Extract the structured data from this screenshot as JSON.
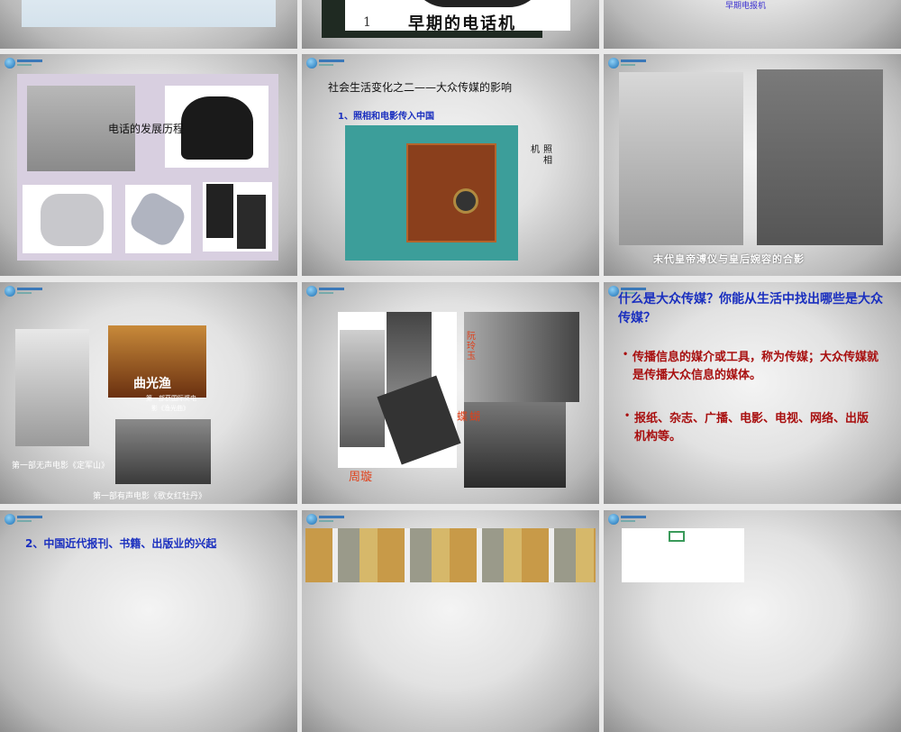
{
  "slides": [
    {
      "index": 1,
      "texts": []
    },
    {
      "index": 2,
      "number": "1",
      "caption": "早期的电话机"
    },
    {
      "index": 3,
      "caption": "早期电报机"
    },
    {
      "index": 4,
      "caption": "电话的发展历程"
    },
    {
      "index": 5,
      "title": "社会生活变化之二——大众传媒的影响",
      "subtitle": "1、照相和电影传入中国",
      "label_col1": "照",
      "label_col1b": "相",
      "label_col2": "机"
    },
    {
      "index": 6,
      "caption": "末代皇帝溥仪与皇后婉容的合影"
    },
    {
      "index": 7,
      "caption_silent": "第一部无声电影《定军山》",
      "caption_award_1": "第一部获国际奖电",
      "caption_award_2": "影《渔光曲》",
      "poster_title": "渔光曲",
      "poster_subtitle": "Song of The Fishermen",
      "caption_sound": "第一部有声电影《歌女红牡丹》"
    },
    {
      "index": 8,
      "name_zhouxuan": "周璇",
      "name_ruan": "阮玲玉",
      "name_hudie": "蝴蝶"
    },
    {
      "index": 9,
      "question": "什么是大众传媒？你能从生活中找出哪些是大众传媒？",
      "bullet1": "传播信息的媒介或工具，称为传媒；大众传媒就是传播大众信息的媒体。",
      "bullet2": "报纸、杂志、广播、电影、电视、网络、出版机构等。"
    },
    {
      "index": 10,
      "title": "2、中国近代报刊、书籍、出版业的兴起"
    },
    {
      "index": 11
    },
    {
      "index": 12
    }
  ],
  "colors": {
    "title_blue": "#1a2fbf",
    "body_red": "#a80f0f",
    "name_orange": "#e0401a"
  }
}
